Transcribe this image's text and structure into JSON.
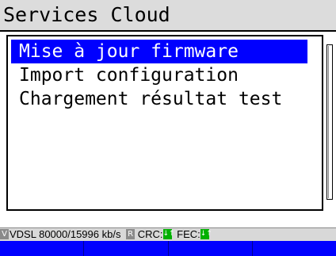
{
  "header": {
    "title": "Services Cloud"
  },
  "menu": {
    "items": [
      {
        "label": "Mise à jour firmware",
        "selected": true
      },
      {
        "label": "Import configuration",
        "selected": false
      },
      {
        "label": "Chargement résultat test",
        "selected": false
      }
    ]
  },
  "status_bar": {
    "line_badge": "V",
    "line_text": "VDSL  80000/15996 kb/s",
    "r_badge": "R",
    "crc_label": "CRC:",
    "crc_icon": "↓↑",
    "fec_label": "FEC:",
    "fec_icon": "↓↑"
  },
  "softkeys": [
    "",
    "",
    "",
    ""
  ],
  "colors": {
    "selection": "#0000ff",
    "softkey_bar": "#0000ff",
    "ok_indicator": "#00b000"
  }
}
